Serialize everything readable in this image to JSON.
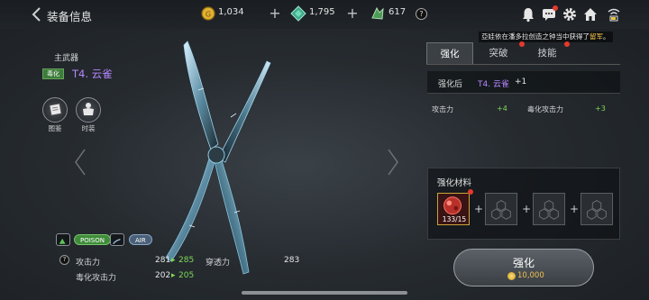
{
  "header": {
    "title": "装备信息",
    "gold": "1,034",
    "gems": "1,795",
    "crystals": "617",
    "help": "?"
  },
  "notice": {
    "prefix": "亞娃依在潘多拉创造之钟当中获得了",
    "highlight": "留军",
    "suffix": "。"
  },
  "weapon": {
    "slot": "主武器",
    "type_badge": "毒化",
    "name": "T4. 云雀"
  },
  "side_buttons": {
    "codex": "图鉴",
    "fashion": "时装"
  },
  "elements": {
    "poison": "POISON",
    "air": "AIR"
  },
  "stats": {
    "help": "?",
    "attack_label": "攻击力",
    "attack_cur": "281",
    "attack_new": "285",
    "pierce_label": "穿透力",
    "pierce_val": "283",
    "poison_attack_label": "毒化攻击力",
    "poison_attack_cur": "202",
    "poison_attack_new": "205"
  },
  "tabs": [
    {
      "label": "强化"
    },
    {
      "label": "突破"
    },
    {
      "label": "技能"
    }
  ],
  "enhance": {
    "after_label": "强化后",
    "after_value": "T4. 云雀",
    "after_level": "+1",
    "bonus_attack_label": "攻击力",
    "bonus_attack": "+4",
    "bonus_poison_label": "毒化攻击力",
    "bonus_poison": "+3"
  },
  "materials": {
    "title": "强化材料",
    "count": "133/15"
  },
  "enhance_button": {
    "label": "强化",
    "cost": "10,000"
  },
  "colors": {
    "accent_purple": "#b687ff",
    "stat_green": "#7ed957",
    "badge_green": "#3d7d3b",
    "notify_red": "#e43a2c",
    "gold": "#f0c050"
  }
}
